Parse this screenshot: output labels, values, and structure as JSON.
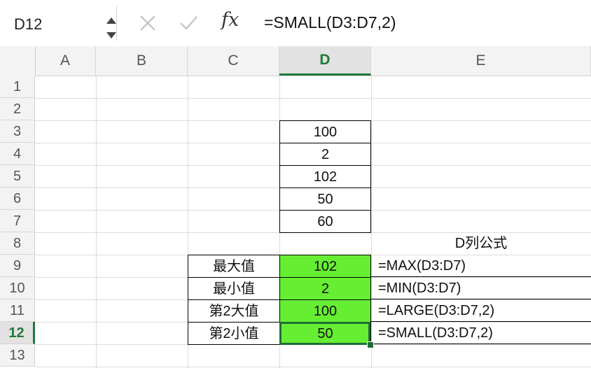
{
  "formula_bar": {
    "name_box": "D12",
    "fx": "fx",
    "formula": "=SMALL(D3:D7,2)"
  },
  "columns": [
    "A",
    "B",
    "C",
    "D",
    "E"
  ],
  "active_column": "D",
  "rows": [
    "1",
    "2",
    "3",
    "4",
    "5",
    "6",
    "7",
    "8",
    "9",
    "10",
    "11",
    "12",
    "13"
  ],
  "active_row": "12",
  "values_d": [
    "100",
    "2",
    "102",
    "50",
    "60"
  ],
  "e8_header": "D列公式",
  "results": [
    {
      "label": "最大值",
      "value": "102",
      "formula": "=MAX(D3:D7)"
    },
    {
      "label": "最小值",
      "value": "2",
      "formula": "=MIN(D3:D7)"
    },
    {
      "label": "第2大值",
      "value": "100",
      "formula": "=LARGE(D3:D7,2)"
    },
    {
      "label": "第2小值",
      "value": "50",
      "formula": "=SMALL(D3:D7,2)"
    }
  ],
  "colors": {
    "accent": "#1f7a3a",
    "highlight": "#66ee33"
  }
}
